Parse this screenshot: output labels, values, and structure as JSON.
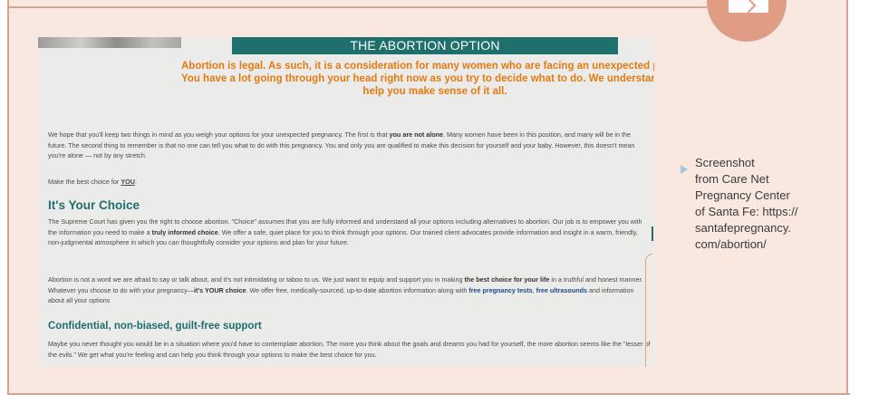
{
  "page_title": "THE ABORTION OPTION",
  "intro_lines": [
    "Abortion is legal. As such, it is a consideration for many women who are facing an unexpected pregnancy.",
    "You have a lot going through your head right now as you try to decide what to do. We understand and can",
    "help you make sense of it all."
  ],
  "para1": {
    "before": "We hope that you'll keep two things in mind as you weigh your options for your unexpected pregnancy. The first is that ",
    "bold": "you are not alone",
    "after": ". Many women have been in this position, and many will be in the future. The second thing to remember is that no one can tell you what to do with this pregnancy. You and only you are qualified to make this decision for yourself and your baby. However, this doesn't mean you're alone — not by any stretch."
  },
  "para2": {
    "before": "Make the best choice for ",
    "emph": "YOU",
    "after": "."
  },
  "heading_choice": "It's Your Choice",
  "para3": {
    "before": "The Supreme Court has given you the right to choose abortion. \"Choice\" assumes that you are fully informed and understand all your options including alternatives to abortion. Our job is to empower you with the information you need to make a ",
    "bold": "truly informed choice",
    "after": ". We offer a safe, quiet place for you to think through your options. Our trained client advocates provide information and insight in a warm, friendly, non-judgmental atmosphere in which you can thoughtfully consider your options and plan for your future."
  },
  "para4": {
    "before": "Abortion is not a word we are afraid to say or talk about, and it's not intimidating or taboo to us. We just want to equip and support you in making ",
    "bold1": "the best choice for your life",
    "mid": " in a truthful and honest manner. Whatever you choose to do with your pregnancy—",
    "bold2": "it's YOUR choice",
    "mid2": ". We offer free, medically-sourced, up-to-date abortion information along with ",
    "link1": "free pregnancy tests",
    "sep": ", ",
    "link2": "free ultrasounds",
    "after": " and information about all your options"
  },
  "heading_support": "Confidential, non-biased, guilt-free support",
  "para5": "Maybe you never thought you would be in a situation where you'd have to contemplate abortion. The more you think about the goals and dreams you had for yourself, the more abortion seems like the \"lesser of the evils.\" We get what you're feeling and can help you think through your options to make the best choice for you.",
  "caption_lines": [
    "Screenshot",
    "from Care Net",
    "Pregnancy Center",
    "of Santa Fe: https://",
    "santafepregnancy.",
    "com/abortion/"
  ],
  "icons": {
    "badge": "laptop-icon",
    "caption_marker": "triangle-bullet-icon"
  },
  "colors": {
    "teal": "#1f6f6d",
    "orange": "#e47a12",
    "frame": "#f9e8e0",
    "border": "#d7a292"
  }
}
